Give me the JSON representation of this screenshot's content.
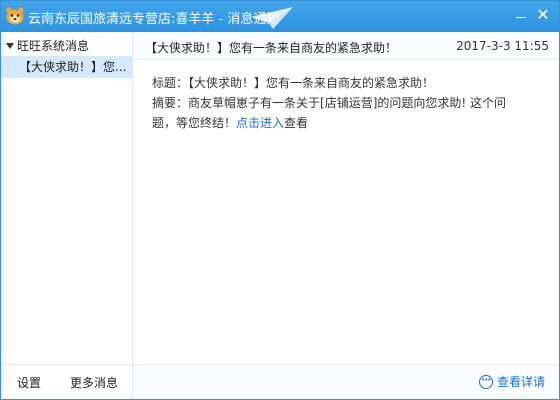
{
  "window": {
    "title": "云南东辰国旅清远专营店:喜羊羊 - 消息通知",
    "minimize_icon": "minimize-icon",
    "close_glyph": "✕"
  },
  "sidebar": {
    "group_label": "旺旺系统消息",
    "items": [
      {
        "label": "【大侠求助！】您..."
      }
    ],
    "footer": {
      "settings_label": "设置",
      "more_label": "更多消息"
    }
  },
  "message": {
    "header_subject": "【大侠求助！】您有一条来自商友的紧急求助！",
    "date": "2017-3-3 11:55",
    "title_label": "标题：",
    "title_value": "【大侠求助！】您有一条来自商友的紧急求助！",
    "summary_label": "摘要：",
    "summary_line1": "商友草帽崽子有一条关于[店铺运营]的问题向您求助! 这个问",
    "summary_line2_prefix": "题，等您终结！",
    "summary_link": "点击进入",
    "summary_suffix": "查看"
  },
  "footer": {
    "detail_label": "查看详请"
  },
  "colors": {
    "titlebar": "#2f93df",
    "selected_item": "#d4e9fb",
    "link": "#1a6fd1"
  }
}
